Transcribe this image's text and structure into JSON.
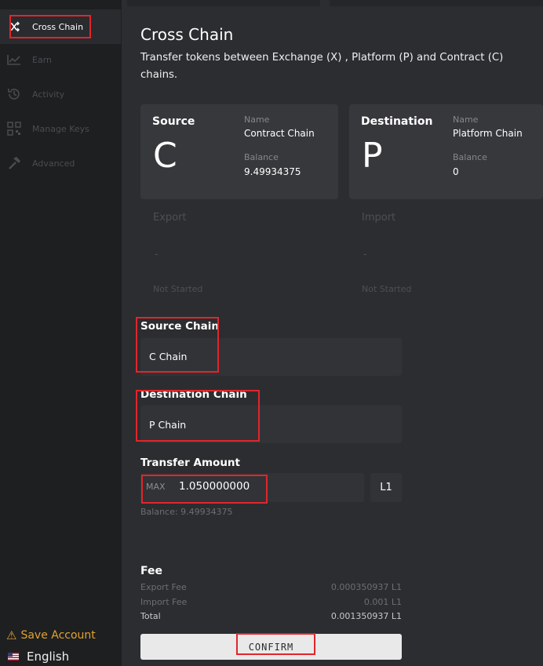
{
  "sidebar": {
    "items": [
      {
        "label": "Cross Chain",
        "icon": "shuffle-icon",
        "active": true
      },
      {
        "label": "Earn",
        "icon": "chart-line-icon"
      },
      {
        "label": "Activity",
        "icon": "history-icon"
      },
      {
        "label": "Manage Keys",
        "icon": "qr-keys-icon"
      },
      {
        "label": "Advanced",
        "icon": "hammer-icon"
      }
    ],
    "save_account": "Save Account",
    "language": "English"
  },
  "page": {
    "title": "Cross Chain",
    "subtitle": "Transfer tokens between Exchange (X) , Platform (P) and Contract (C) chains."
  },
  "source_card": {
    "role": "Source",
    "letter": "C",
    "name_label": "Name",
    "name": "Contract Chain",
    "balance_label": "Balance",
    "balance": "9.49934375"
  },
  "destination_card": {
    "role": "Destination",
    "letter": "P",
    "name_label": "Name",
    "name": "Platform Chain",
    "balance_label": "Balance",
    "balance": "0"
  },
  "export_status": {
    "label": "Export",
    "value": "-",
    "state": "Not Started"
  },
  "import_status": {
    "label": "Import",
    "value": "-",
    "state": "Not Started"
  },
  "form": {
    "source_chain_label": "Source Chain",
    "source_chain_value": "C Chain",
    "destination_chain_label": "Destination Chain",
    "destination_chain_value": "P Chain",
    "transfer_amount_label": "Transfer Amount",
    "max_label": "MAX",
    "amount": "1.050000000",
    "unit": "L1",
    "balance_line": "Balance: 9.49934375"
  },
  "fee": {
    "title": "Fee",
    "rows": [
      {
        "label": "Export Fee",
        "value": "0.000350937 L1"
      },
      {
        "label": "Import Fee",
        "value": "0.001 L1"
      },
      {
        "label": "Total",
        "value": "0.001350937 L1"
      }
    ]
  },
  "confirm_label": "CONFIRM",
  "colors": {
    "highlight": "#e0262b",
    "warning": "#e0a332",
    "panel": "#2c2d30",
    "card": "#37383c"
  }
}
